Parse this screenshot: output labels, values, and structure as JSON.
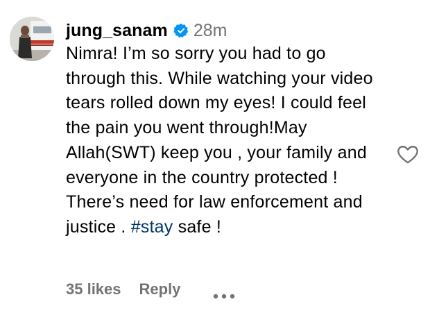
{
  "comment": {
    "username": "jung_sanam",
    "verified": true,
    "timestamp": "28m",
    "text_before_hashtag": "Nimra! I’m so sorry you had to go through this. While watching your video tears rolled down my eyes! I could feel the pain you went through!May Allah(SWT) keep you , your family and everyone in the country protected ! There’s need for law enforcement and justice . ",
    "hashtag": "#stay",
    "text_after_hashtag": " safe !",
    "likes_label": "35 likes",
    "reply_label": "Reply"
  },
  "icons": {
    "verified": "verified-badge-icon",
    "like": "heart-outline-icon",
    "more": "more-options-icon"
  },
  "colors": {
    "verified_badge": "#0095f6",
    "hashtag": "#00376b",
    "secondary_text": "#737373"
  }
}
